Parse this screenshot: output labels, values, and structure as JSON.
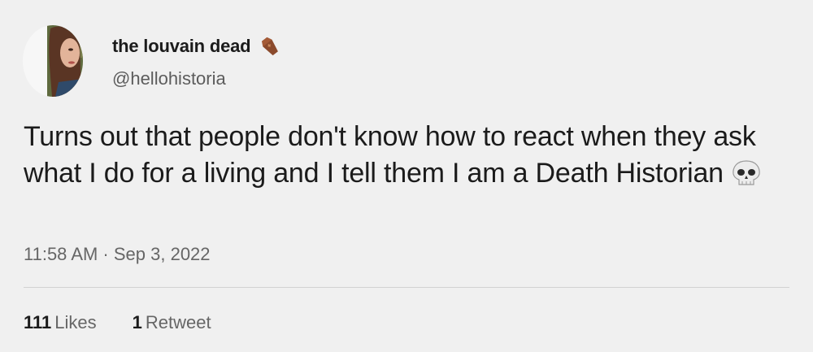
{
  "author": {
    "display_name": "the louvain dead",
    "name_emoji": "coffin-icon",
    "handle": "@hellohistoria"
  },
  "tweet": {
    "text": "Turns out that people don't know how to react when they ask what I do for a living and I tell them I am a Death Historian",
    "trailing_emoji": "skull-icon"
  },
  "timestamp": "11:58 AM · Sep 3, 2022",
  "stats": {
    "likes_count": "111",
    "likes_label": "Likes",
    "retweets_count": "1",
    "retweets_label": "Retweet"
  },
  "colors": {
    "background": "#f0f0f0",
    "text_primary": "#1b1b1b",
    "text_secondary": "#666666",
    "divider": "#d2d2d2"
  }
}
